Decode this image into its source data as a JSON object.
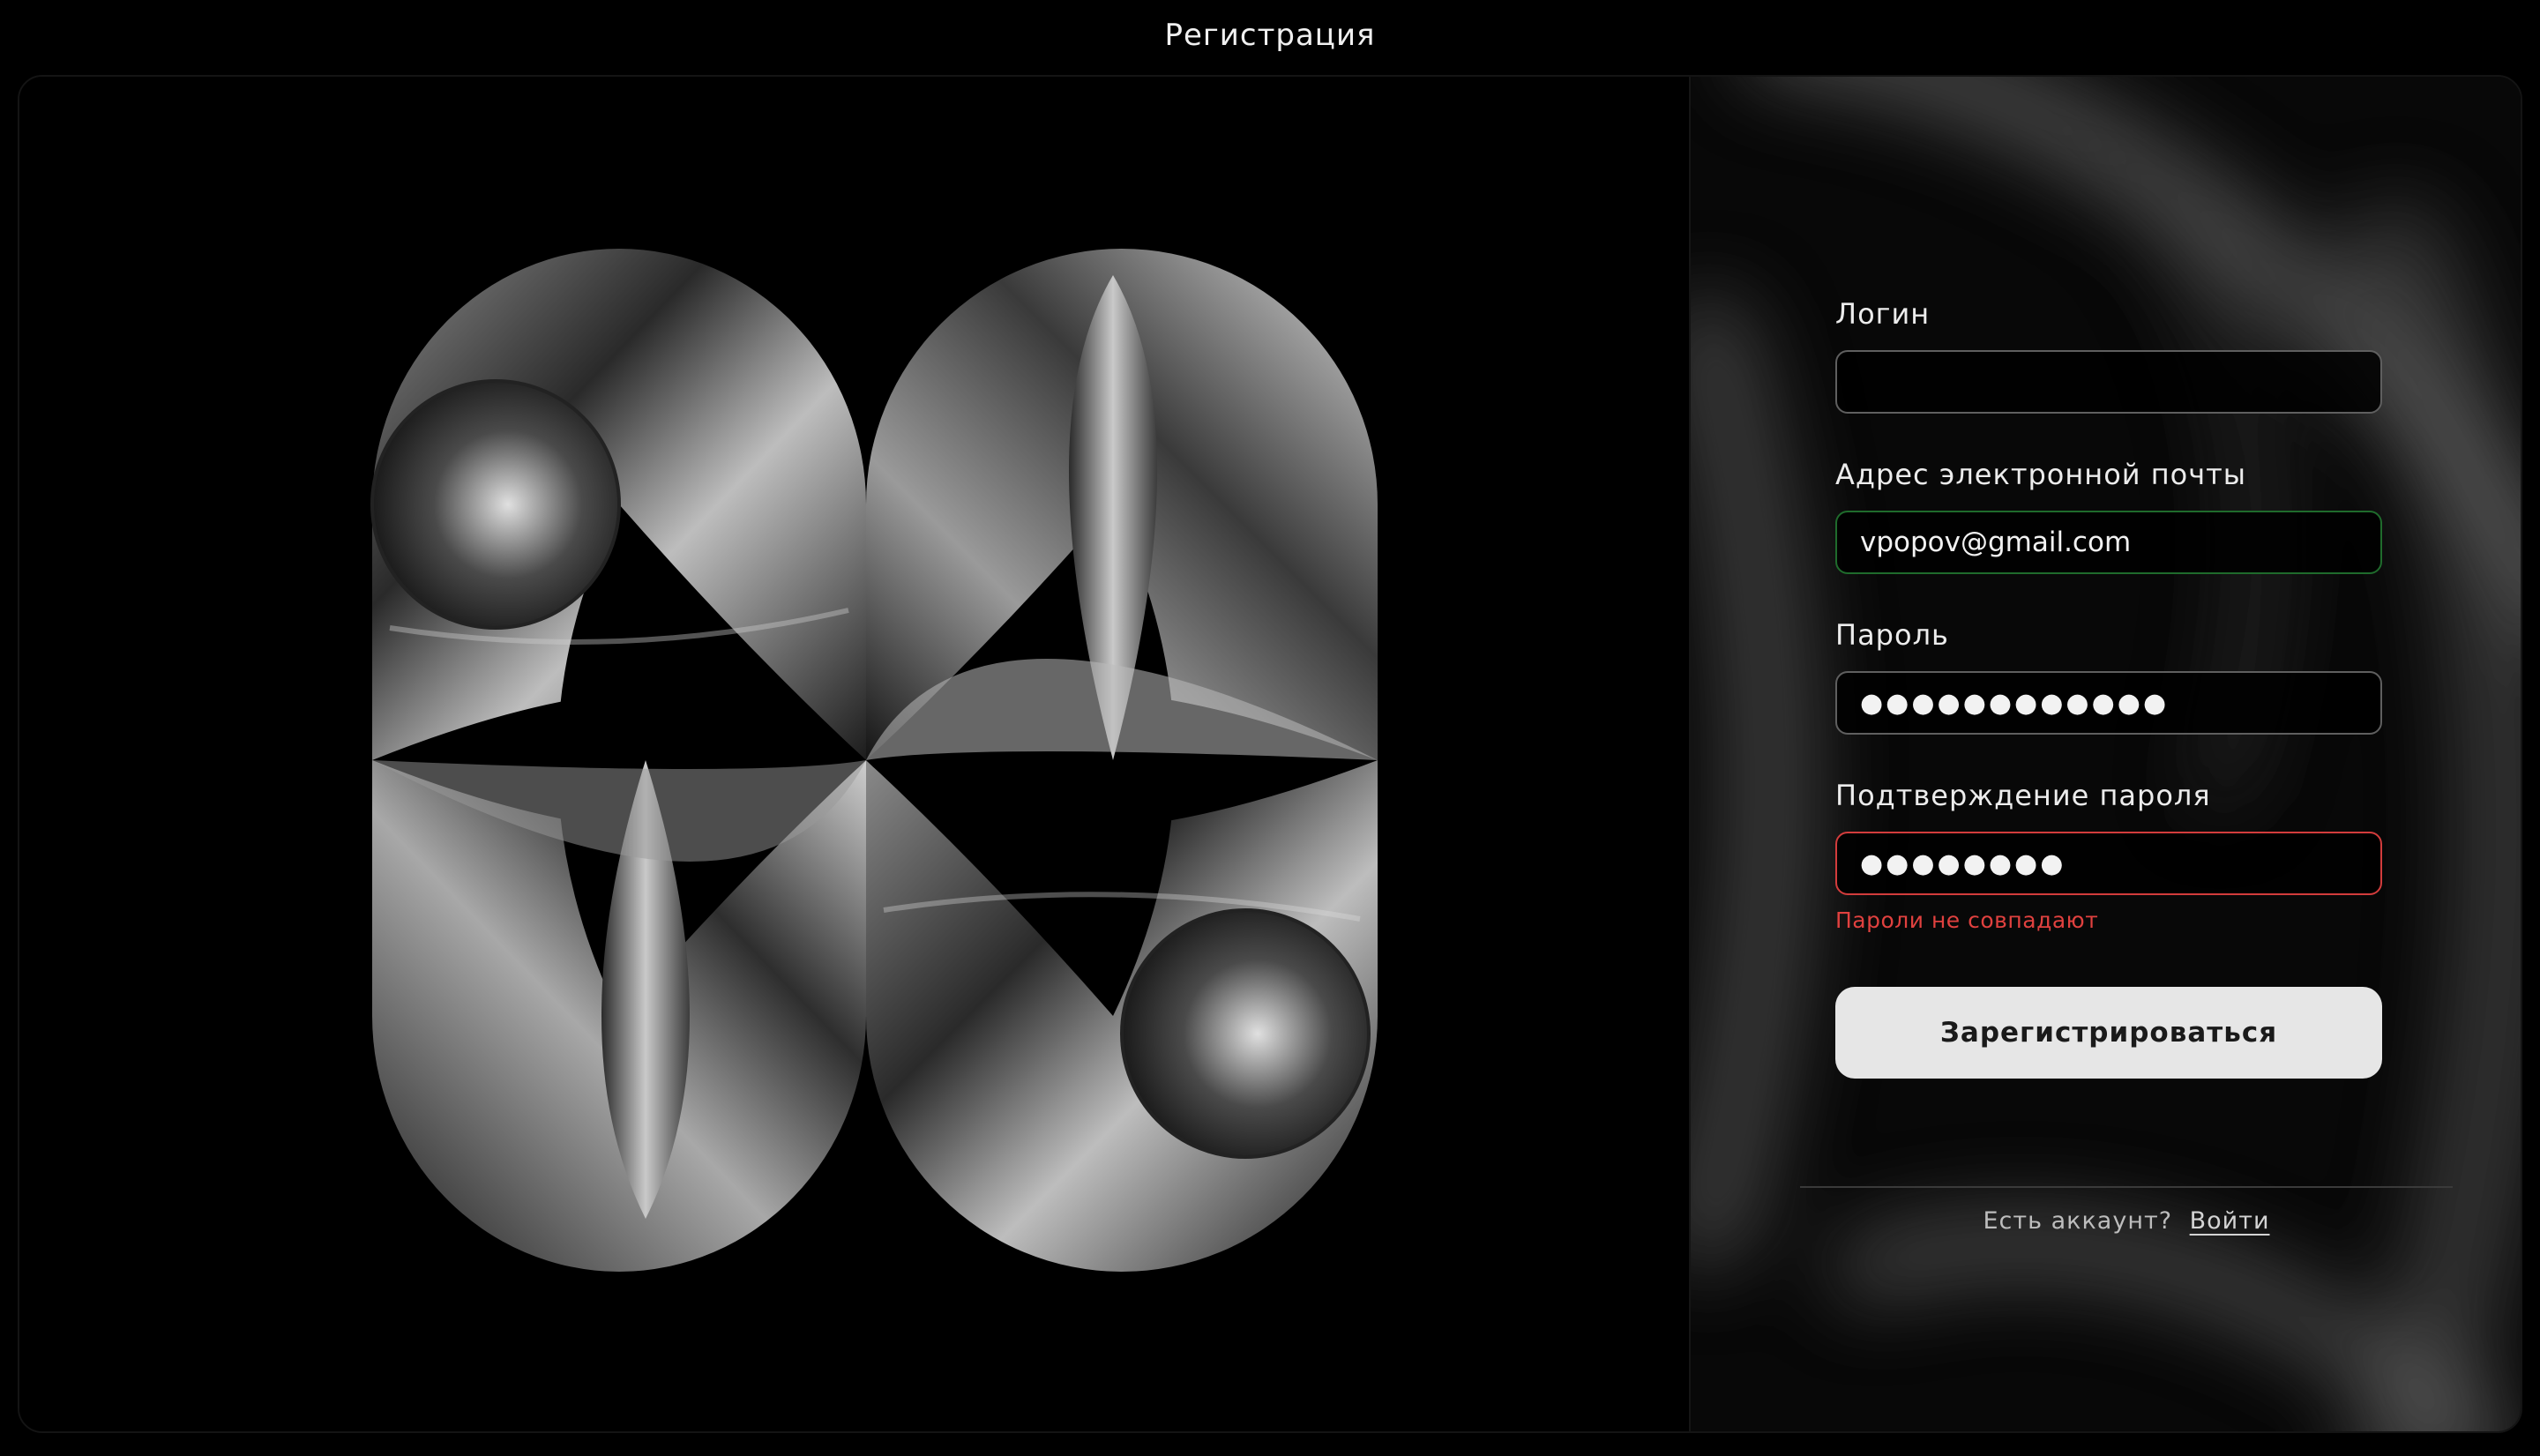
{
  "header": {
    "title": "Регистрация"
  },
  "form": {
    "login": {
      "label": "Логин",
      "value": "",
      "placeholder": ""
    },
    "email": {
      "label": "Адрес электронной почты",
      "value": "vpopov@gmail.com"
    },
    "password": {
      "label": "Пароль",
      "value": "●●●●●●●●●●●●"
    },
    "confirm": {
      "label": "Подтверждение пароля",
      "value": "●●●●●●●●",
      "error": "Пароли не совпадают"
    },
    "submit_label": "Зарегистрироваться"
  },
  "footer": {
    "prompt": "Есть аккаунт?",
    "login_link": "Войти"
  },
  "colors": {
    "background": "#000000",
    "valid_border": "#1f6b2c",
    "error": "#e0413f",
    "button_bg": "#e6e6e6"
  }
}
